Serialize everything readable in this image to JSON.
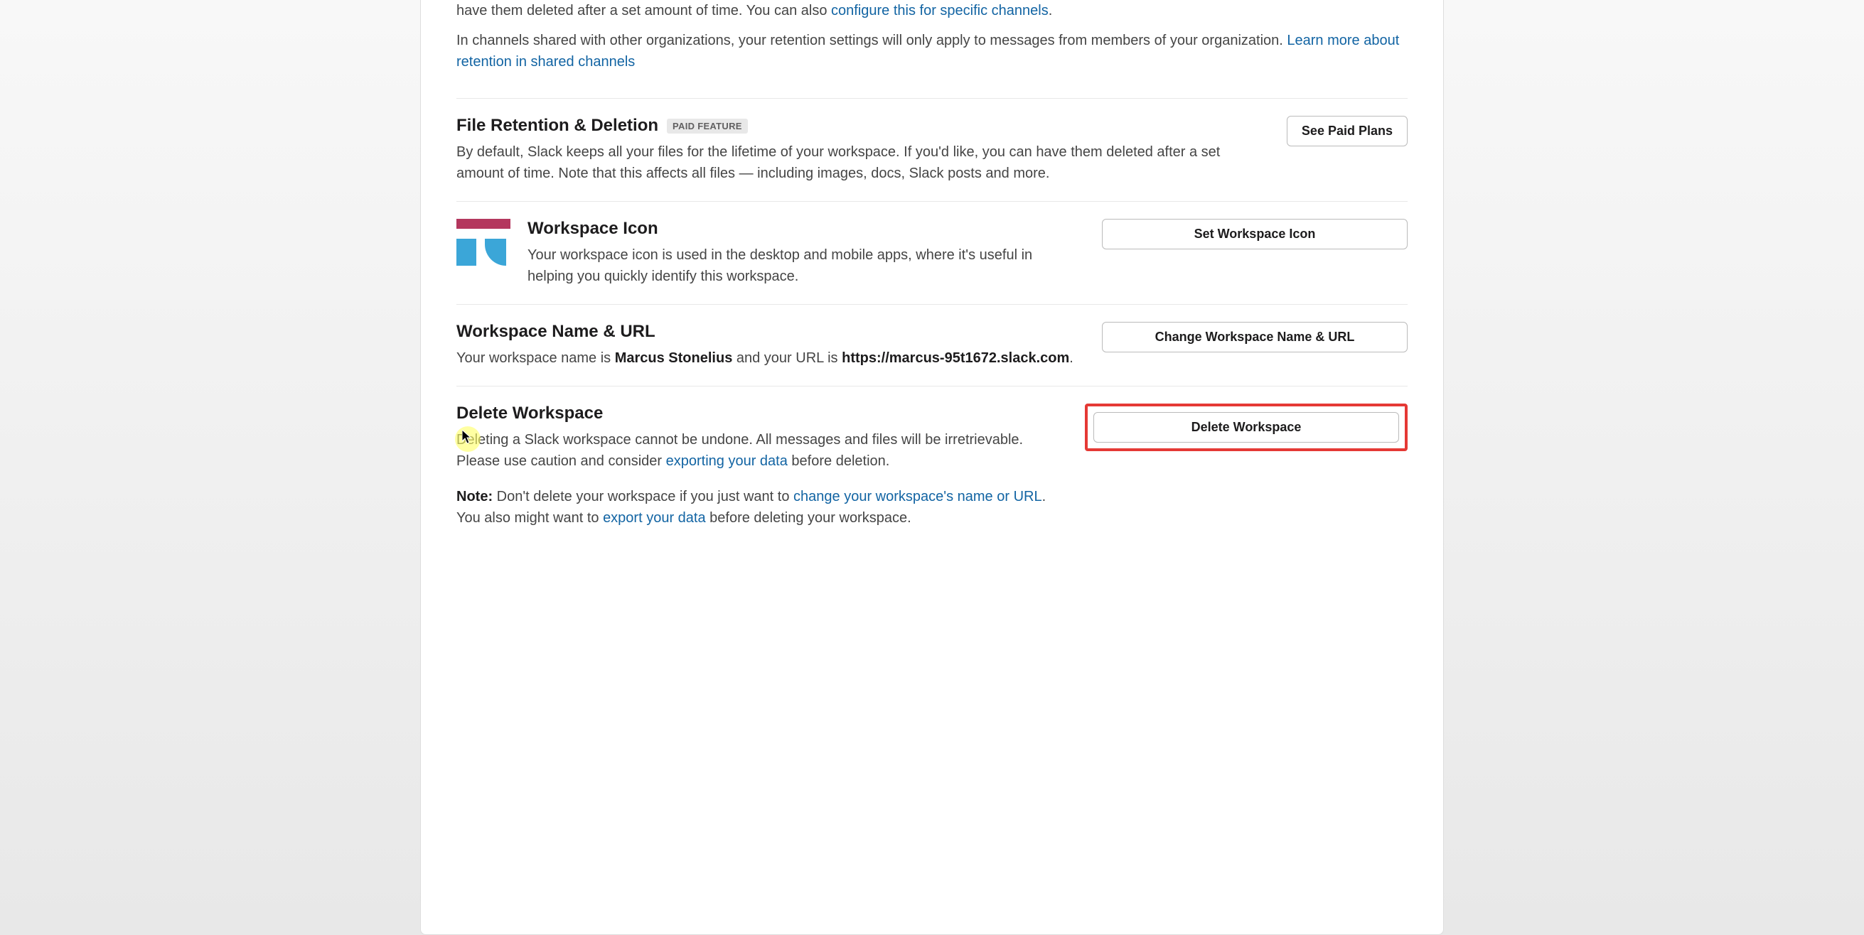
{
  "top": {
    "p1_prefix": "have them deleted after a set amount of time. You can also ",
    "p1_link": "configure this for specific channels",
    "p1_suffix": ".",
    "p2_prefix": "In channels shared with other organizations, your retention settings will only apply to messages from members of your organization. ",
    "p2_link": "Learn more about retention in shared channels"
  },
  "file_retention": {
    "title": "File Retention & Deletion",
    "badge": "PAID FEATURE",
    "desc": "By default, Slack keeps all your files for the lifetime of your workspace. If you'd like, you can have them deleted after a set amount of time. Note that this affects all files — including images, docs, Slack posts and more.",
    "button": "See Paid Plans"
  },
  "workspace_icon": {
    "title": "Workspace Icon",
    "desc": "Your workspace icon is used in the desktop and mobile apps, where it's useful in helping you quickly identify this workspace.",
    "button": "Set Workspace Icon"
  },
  "workspace_name": {
    "title": "Workspace Name & URL",
    "desc_prefix": "Your workspace name is ",
    "name": "Marcus Stonelius",
    "desc_mid": " and your URL is ",
    "url": "https://marcus-95t1672.slack.com",
    "desc_suffix": ".",
    "button": "Change Workspace Name & URL"
  },
  "delete_workspace": {
    "title": "Delete Workspace",
    "desc_prefix": "Deleting a Slack workspace cannot be undone. All messages and files will be irretrievable. Please use caution and consider ",
    "link1": "exporting your data",
    "desc_suffix": " before deletion.",
    "note_label": "Note:",
    "note_prefix": " Don't delete your workspace if you just want to ",
    "note_link1": "change your workspace's name or URL",
    "note_mid": ". You also might want to ",
    "note_link2": "export your data",
    "note_suffix": " before deleting your workspace.",
    "button": "Delete Workspace"
  }
}
